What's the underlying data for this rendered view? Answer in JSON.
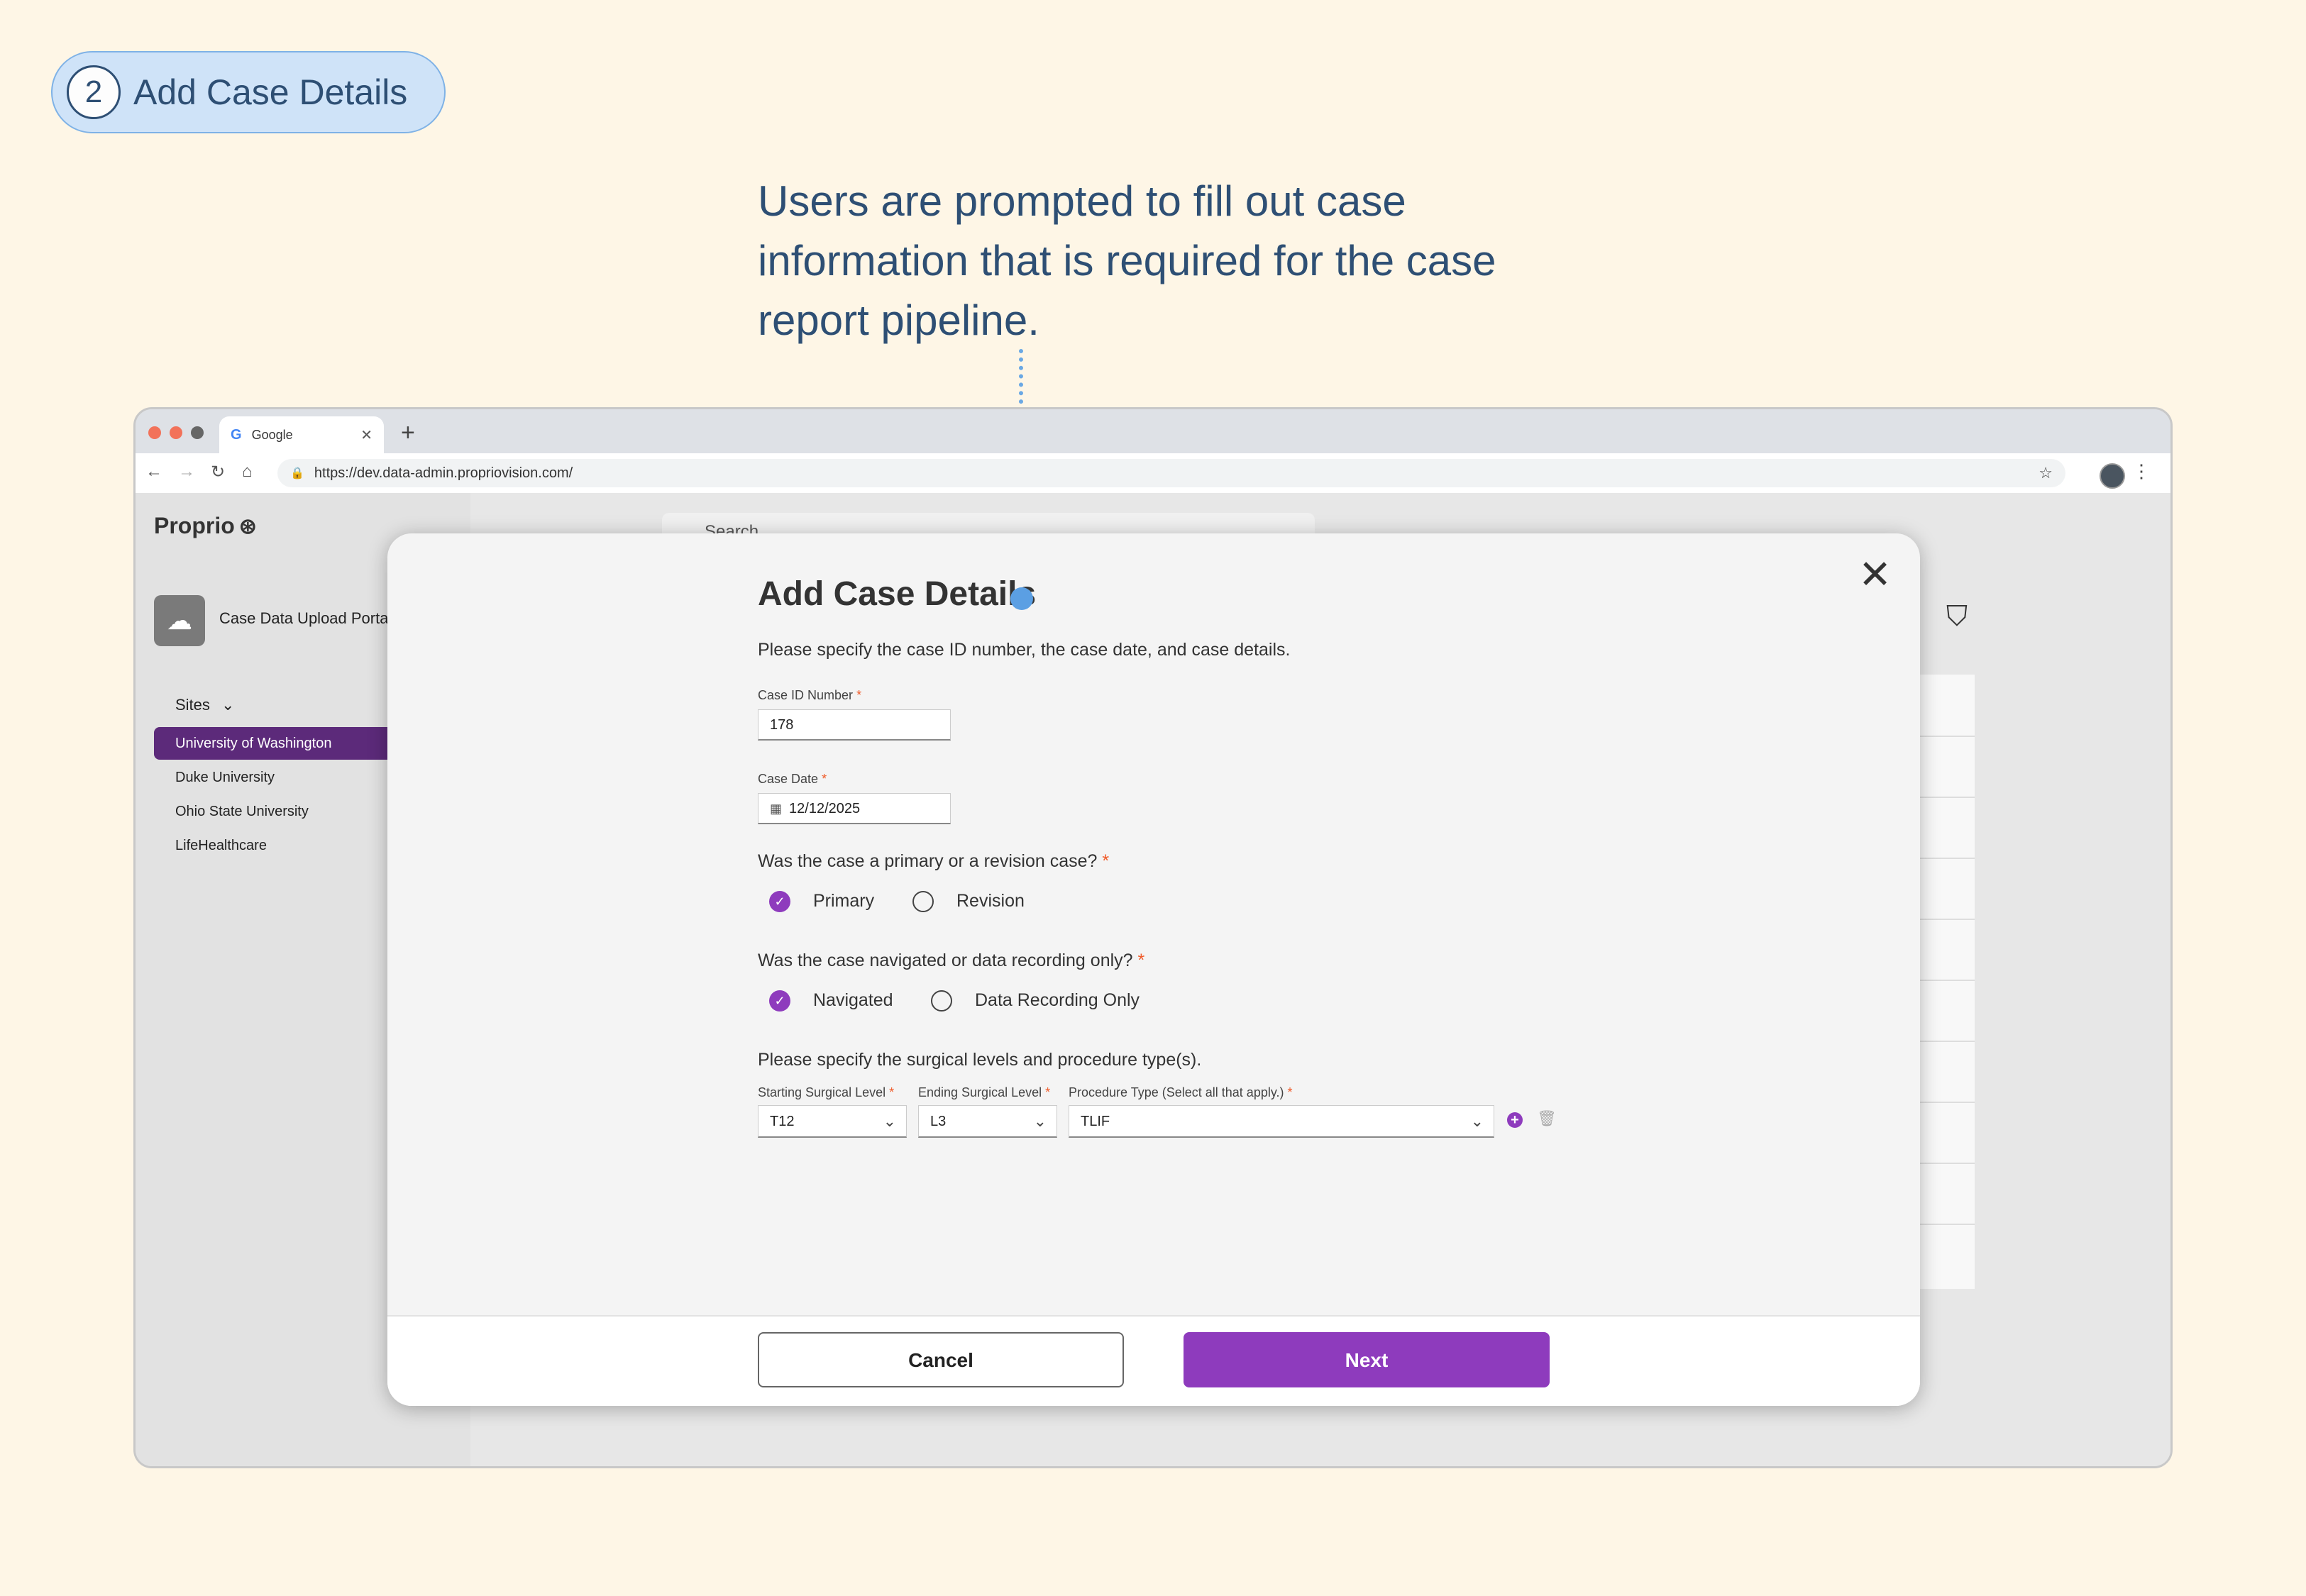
{
  "step": {
    "number": "2",
    "title": "Add Case Details"
  },
  "annotation": "Users are prompted to fill out case information that is required for the case report pipeline.",
  "browser": {
    "tab_title": "Google",
    "tab_icon": "G",
    "url": "https://dev.data-admin.propriovision.com/"
  },
  "app": {
    "logo": "Proprio",
    "portal_label": "Case Data Upload Porta",
    "sites_header": "Sites",
    "sites": [
      {
        "label": "University of Washington",
        "active": true
      },
      {
        "label": "Duke University",
        "active": false
      },
      {
        "label": "Ohio State University",
        "active": false
      },
      {
        "label": "LifeHealthcare",
        "active": false
      }
    ],
    "search_placeholder": "Search"
  },
  "modal": {
    "title": "Add Case Details",
    "subtitle": "Please specify the case ID number, the case date, and case details.",
    "case_id": {
      "label": "Case ID Number",
      "value": "178"
    },
    "case_date": {
      "label": "Case Date",
      "value": "12/12/2025"
    },
    "q_primary": {
      "question": "Was the case a primary or a revision case?",
      "options": [
        "Primary",
        "Revision"
      ],
      "selected": "Primary"
    },
    "q_navigated": {
      "question": "Was the case navigated or data recording only?",
      "options": [
        "Navigated",
        "Data Recording Only"
      ],
      "selected": "Navigated"
    },
    "levels_prompt": "Please specify the surgical levels and procedure type(s).",
    "start_level": {
      "label": "Starting Surgical Level",
      "value": "T12"
    },
    "end_level": {
      "label": "Ending Surgical Level",
      "value": "L3"
    },
    "procedure": {
      "label": "Procedure Type (Select all that apply.)",
      "value": "TLIF"
    },
    "required_mark": "*",
    "cancel_label": "Cancel",
    "next_label": "Next"
  },
  "colors": {
    "accent": "#8e3bbd",
    "sidebar_active": "#5c2a7a",
    "badge_bg": "#cfe3f8",
    "page_bg": "#fef6e6"
  }
}
